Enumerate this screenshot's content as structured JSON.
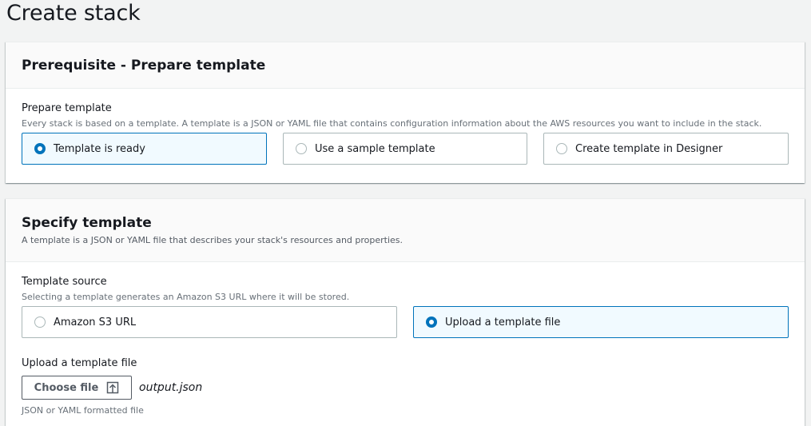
{
  "page": {
    "title": "Create stack"
  },
  "prerequisite": {
    "heading": "Prerequisite - Prepare template",
    "field_label": "Prepare template",
    "field_description": "Every stack is based on a template. A template is a JSON or YAML file that contains configuration information about the AWS resources you want to include in the stack.",
    "options": [
      {
        "label": "Template is ready",
        "selected": true
      },
      {
        "label": "Use a sample template",
        "selected": false
      },
      {
        "label": "Create template in Designer",
        "selected": false
      }
    ]
  },
  "specify": {
    "heading": "Specify template",
    "description": "A template is a JSON or YAML file that describes your stack's resources and properties.",
    "source_label": "Template source",
    "source_description": "Selecting a template generates an Amazon S3 URL where it will be stored.",
    "source_options": [
      {
        "label": "Amazon S3 URL",
        "selected": false
      },
      {
        "label": "Upload a template file",
        "selected": true
      }
    ],
    "upload_label": "Upload a template file",
    "choose_file_label": "Choose file",
    "choose_file_icon": "upload-icon",
    "file_name": "output.json",
    "upload_hint": "JSON or YAML formatted file"
  },
  "colors": {
    "accent": "#0073bb",
    "selected_bg": "#f1faff",
    "page_bg": "#f2f3f3"
  }
}
